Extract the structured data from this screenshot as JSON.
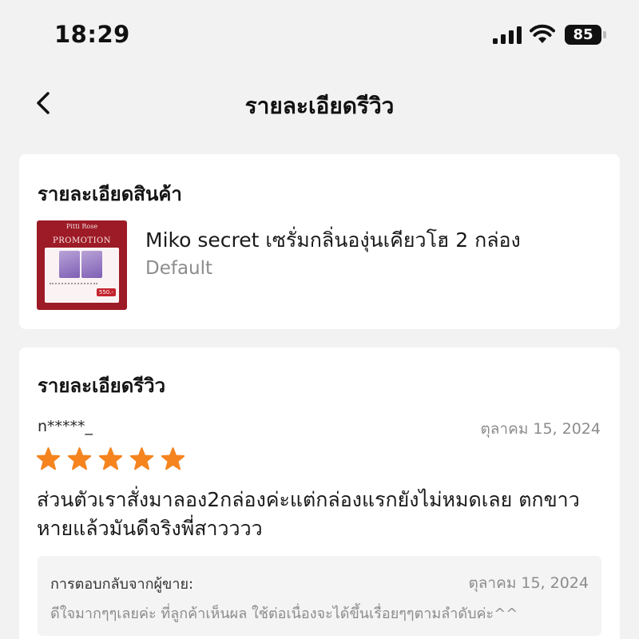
{
  "status_bar": {
    "time": "18:29",
    "battery_level": "85",
    "icons": [
      "signal-icon",
      "wifi-icon",
      "battery-icon"
    ]
  },
  "nav": {
    "title": "รายละเอียดรีวิว",
    "back_icon": "chevron-left-icon"
  },
  "product_section": {
    "title": "รายละเอียดสินค้า",
    "product_name": "Miko secret เซรั่มกลิ่นองุ่นเคียวโฮ 2 กล่อง",
    "variant": "Default",
    "thumbnail": {
      "brand": "Pitti Rose",
      "banner": "PROMOTION",
      "price_tag": "550.-"
    }
  },
  "review_section": {
    "title": "รายละเอียดรีวิว",
    "reviewer": "n*****_",
    "date": "ตุลาคม 15, 2024",
    "rating": 5,
    "text": "ส่วนตัวเราสั่งมาลอง2กล่องค่ะแต่กล่องแรกยังไม่หมดเลย ตกขาวหายแล้วมันดีจริงพี่สาวววว",
    "reply": {
      "label": "การตอบกลับจากผู้ขาย:",
      "date": "ตุลาคม 15, 2024",
      "text": "ดีใจมากๆๆเลยค่ะ  ที่ลูกค้าเห็นผล ใช้ต่อเนื่องจะได้ขึ้นเรื่อยๆๆตามลำดับค่ะ^^"
    }
  },
  "colors": {
    "background": "#f2f2f2",
    "card": "#ffffff",
    "star": "#f5841f",
    "muted_text": "#8c8c8c",
    "thumbnail_red": "#9d1b26"
  }
}
